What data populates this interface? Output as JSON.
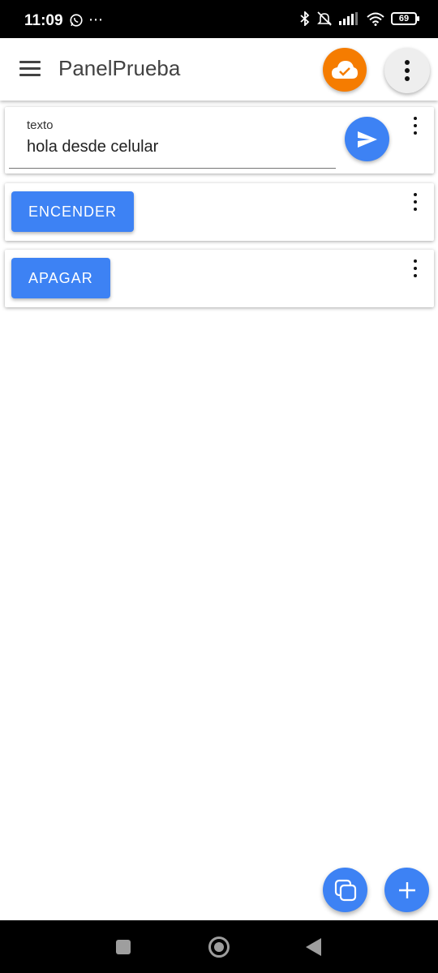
{
  "status_bar": {
    "time": "11:09",
    "battery": "69",
    "icons": [
      "whatsapp-icon",
      "more-dots-icon",
      "bluetooth-icon",
      "mute-icon",
      "signal-icon",
      "wifi-icon",
      "battery-icon"
    ]
  },
  "app_bar": {
    "title": "PanelPrueba",
    "menu_icon": "hamburger-icon",
    "cloud_icon": "cloud-check-icon",
    "more_icon": "more-vert-icon"
  },
  "cards": {
    "text_card": {
      "label": "texto",
      "value": "hola desde celular",
      "send_icon": "send-icon"
    },
    "encender_card": {
      "button_label": "ENCENDER"
    },
    "apagar_card": {
      "button_label": "APAGAR"
    }
  },
  "fabs": {
    "copy_icon": "copy-icon",
    "add_icon": "add-icon"
  },
  "colors": {
    "primary": "#3d82f4",
    "accent": "#f57c00"
  }
}
